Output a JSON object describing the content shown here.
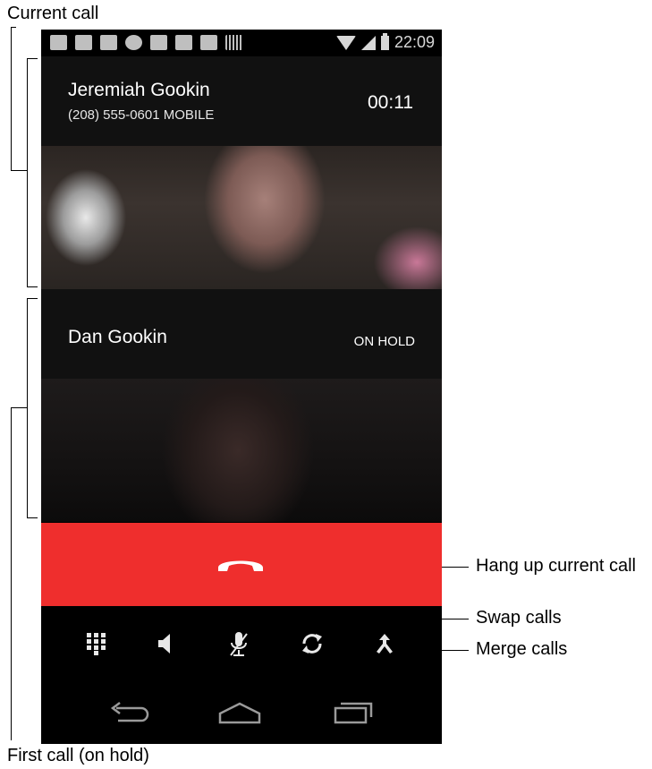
{
  "annotations": {
    "current_call": "Current call",
    "first_call": "First call (on hold)",
    "hang_up": "Hang up current call",
    "swap": "Swap calls",
    "merge": "Merge calls"
  },
  "status_bar": {
    "time": "22:09",
    "notification_icons": [
      "message-icon",
      "gmail-icon",
      "missed-call-icon",
      "hangouts-icon",
      "add-contact-icon",
      "play-store-icon",
      "task-done-icon",
      "barcode-icon"
    ],
    "status_icons": [
      "wifi-icon",
      "signal-icon",
      "battery-icon"
    ]
  },
  "current_call": {
    "name": "Jeremiah Gookin",
    "number": "(208) 555-0601  MOBILE",
    "timer": "00:11"
  },
  "held_call": {
    "name": "Dan Gookin",
    "status": "ON HOLD"
  },
  "controls": [
    "dialpad-icon",
    "speaker-icon",
    "mute-icon",
    "swap-calls-icon",
    "merge-calls-icon"
  ],
  "nav": [
    "back-icon",
    "home-icon",
    "recents-icon"
  ],
  "colors": {
    "hangup_red": "#ef2e2d",
    "header_bg": "#111111",
    "phone_bg": "#000000"
  }
}
